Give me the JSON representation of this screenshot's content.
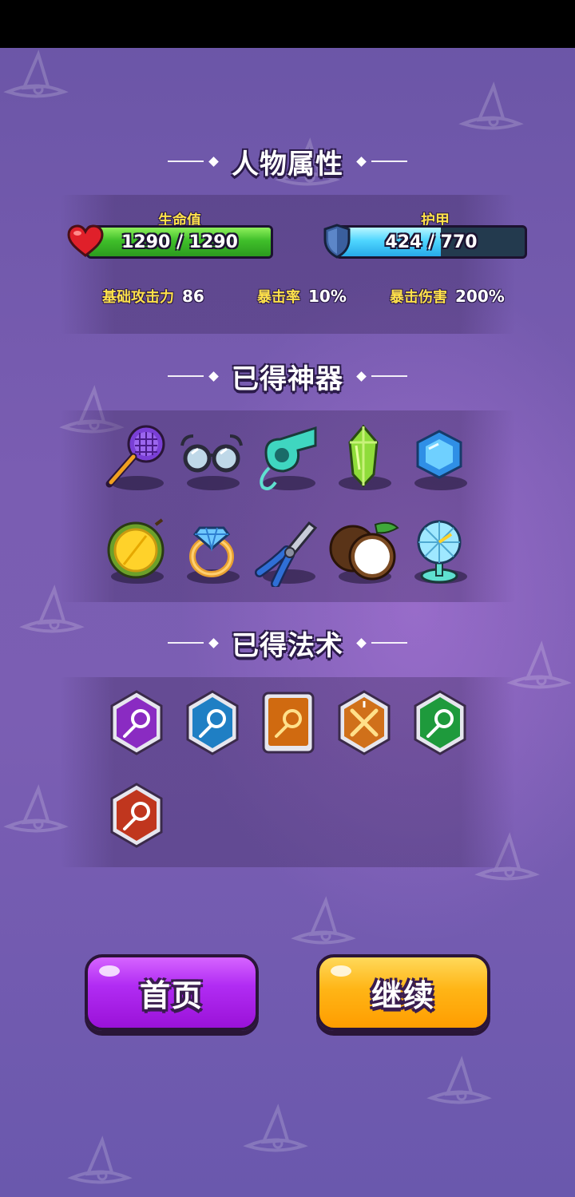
{
  "sections": {
    "attributes_title": "人物属性",
    "artifacts_title": "已得神器",
    "spells_title": "已得法术"
  },
  "health": {
    "label": "生命值",
    "value": "1290 / 1290",
    "fraction": 1.0,
    "color": "#3fbf2a"
  },
  "armor": {
    "label": "护甲",
    "value": "424 / 770",
    "fraction": 0.55,
    "color": "#4fd6ff"
  },
  "stats": [
    {
      "label": "基础攻击力",
      "value": "86"
    },
    {
      "label": "暴击率",
      "value": "10%"
    },
    {
      "label": "暴击伤害",
      "value": "200%"
    }
  ],
  "artifacts": [
    "tennis-racket-icon",
    "glasses-icon",
    "whistle-icon",
    "green-crystal-icon",
    "blue-gem-icon",
    "durian-icon",
    "diamond-ring-icon",
    "pliers-icon",
    "coconut-icon",
    "fan-icon"
  ],
  "spells": [
    {
      "icon": "purple-comet-spell-icon",
      "color": "#8a2bc2"
    },
    {
      "icon": "blue-comet-spell-icon",
      "color": "#1f7fc4"
    },
    {
      "icon": "orange-comet-card-spell-icon",
      "color": "#d06a10"
    },
    {
      "icon": "crossed-swords-spell-icon",
      "color": "#d0701a"
    },
    {
      "icon": "green-comet-spell-icon",
      "color": "#1e9a3c"
    },
    {
      "icon": "red-comet-spell-icon",
      "color": "#c0361e"
    }
  ],
  "buttons": {
    "home": "首页",
    "continue": "继续"
  },
  "colors": {
    "home_button": "#b12cf3",
    "continue_button": "#ffb516",
    "stat_label": "#ffe14a"
  }
}
